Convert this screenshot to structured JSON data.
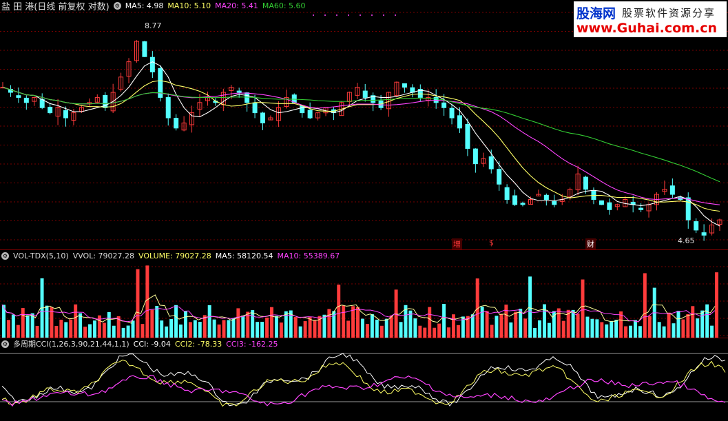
{
  "colors": {
    "bg": "#000000",
    "up": "#ff3b3b",
    "down": "#54ffff",
    "ma5": "#ffffff",
    "ma10": "#ffff66",
    "ma20": "#ff44ff",
    "ma60": "#33cc33",
    "grid": "#7a0000"
  },
  "main": {
    "stock_title": "盐 田 港(日线 前复权 对数)",
    "ma5_label": "MA5: 4.98",
    "ma10_label": "MA10: 5.10",
    "ma20_label": "MA20: 5.41",
    "ma60_label": "MA60: 5.60",
    "high_marker": "8.77",
    "low_marker": "4.65",
    "event_labels": [
      "增",
      "$",
      "财"
    ]
  },
  "volume": {
    "indicator": "VOL-TDX(5,10)",
    "vvol_label": "VVOL: 79027.28",
    "volume_label": "VOLUME: 79027.28",
    "ma5_label": "MA5: 58120.54",
    "ma10_label": "MA10: 55389.67"
  },
  "cci": {
    "indicator": "多周期CCI(1,26,3,90,21,44,1,1)",
    "cci_label": "CCI: -9.04",
    "cci2_label": "CCI2: -78.33",
    "cci3_label": "CCI3: -162.25"
  },
  "logo": {
    "brand": "股海网",
    "tagline": "股票软件资源分享",
    "url": "www.Guhai.com.cn"
  },
  "chart_data": [
    {
      "type": "candlestick",
      "max_price": 8.77,
      "min_price": 4.65,
      "close_trend": [
        7.6,
        7.5,
        7.4,
        7.3,
        7.4,
        7.2,
        7.1,
        7.2,
        7.0,
        7.1,
        7.2,
        7.3,
        7.4,
        7.2,
        7.5,
        7.8,
        8.1,
        8.5,
        8.2,
        7.9,
        7.4,
        7.0,
        6.8,
        6.9,
        7.1,
        7.3,
        7.4,
        7.3,
        7.5,
        7.6,
        7.5,
        7.3,
        7.1,
        6.9,
        7.0,
        7.2,
        7.4,
        7.3,
        7.1,
        7.0,
        7.1,
        7.2,
        7.1,
        7.3,
        7.5,
        7.6,
        7.4,
        7.3,
        7.2,
        7.5,
        7.7,
        7.6,
        7.5,
        7.4,
        7.4,
        7.3,
        7.2,
        7.0,
        6.8,
        6.4,
        6.1,
        6.2,
        6.0,
        5.7,
        5.4,
        5.3,
        5.3,
        5.4,
        5.5,
        5.4,
        5.3,
        5.4,
        5.6,
        5.9,
        5.6,
        5.4,
        5.3,
        5.2,
        5.3,
        5.4,
        5.3,
        5.2,
        5.3,
        5.5,
        5.6,
        5.5,
        5.4,
        5.0,
        4.8,
        4.7,
        4.9,
        5.0
      ],
      "ma_series": [
        "MA5",
        "MA10",
        "MA20",
        "MA60"
      ]
    },
    {
      "type": "bar",
      "name": "VOL-TDX(5,10)",
      "last_value": 79027.28,
      "ma5": 58120.54,
      "ma10": 55389.67
    },
    {
      "type": "line",
      "name": "多周期CCI",
      "series": [
        {
          "name": "CCI",
          "last": -9.04
        },
        {
          "name": "CCI2",
          "last": -78.33
        },
        {
          "name": "CCI3",
          "last": -162.25
        }
      ]
    }
  ]
}
